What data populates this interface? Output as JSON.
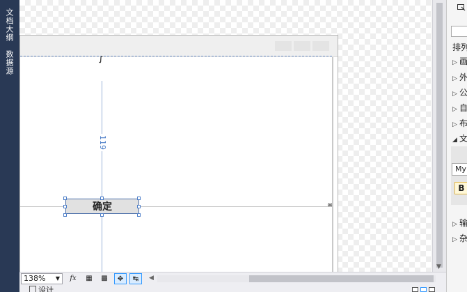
{
  "left_tabs": {
    "document_outline": "文档大纲",
    "data_sources": "数据源"
  },
  "form": {
    "button_label": "确定",
    "distance_label": "119"
  },
  "bottom_toolbar": {
    "zoom": "138%",
    "fx_label": "fx",
    "design_tab": "设计"
  },
  "property_panel": {
    "section_label": "排列",
    "categories": [
      {
        "label": "画",
        "state": "collapsed"
      },
      {
        "label": "外",
        "state": "collapsed"
      },
      {
        "label": "公",
        "state": "collapsed"
      },
      {
        "label": "自",
        "state": "collapsed"
      },
      {
        "label": "布",
        "state": "collapsed"
      },
      {
        "label": "文",
        "state": "expanded"
      }
    ],
    "font_name": "My",
    "bold_label": "B",
    "lower_categories": [
      {
        "label": "输",
        "state": "collapsed"
      },
      {
        "label": "杂",
        "state": "collapsed"
      }
    ]
  },
  "colors": {
    "accent": "#4d7ec8",
    "left_strip": "#293955",
    "selection": "#3399ff"
  },
  "icons": [
    "pointer-icon",
    "fx-icon",
    "grid-icon",
    "snap-icon",
    "resize-icon",
    "scroll-left-arrow",
    "scroll-up-arrow"
  ]
}
